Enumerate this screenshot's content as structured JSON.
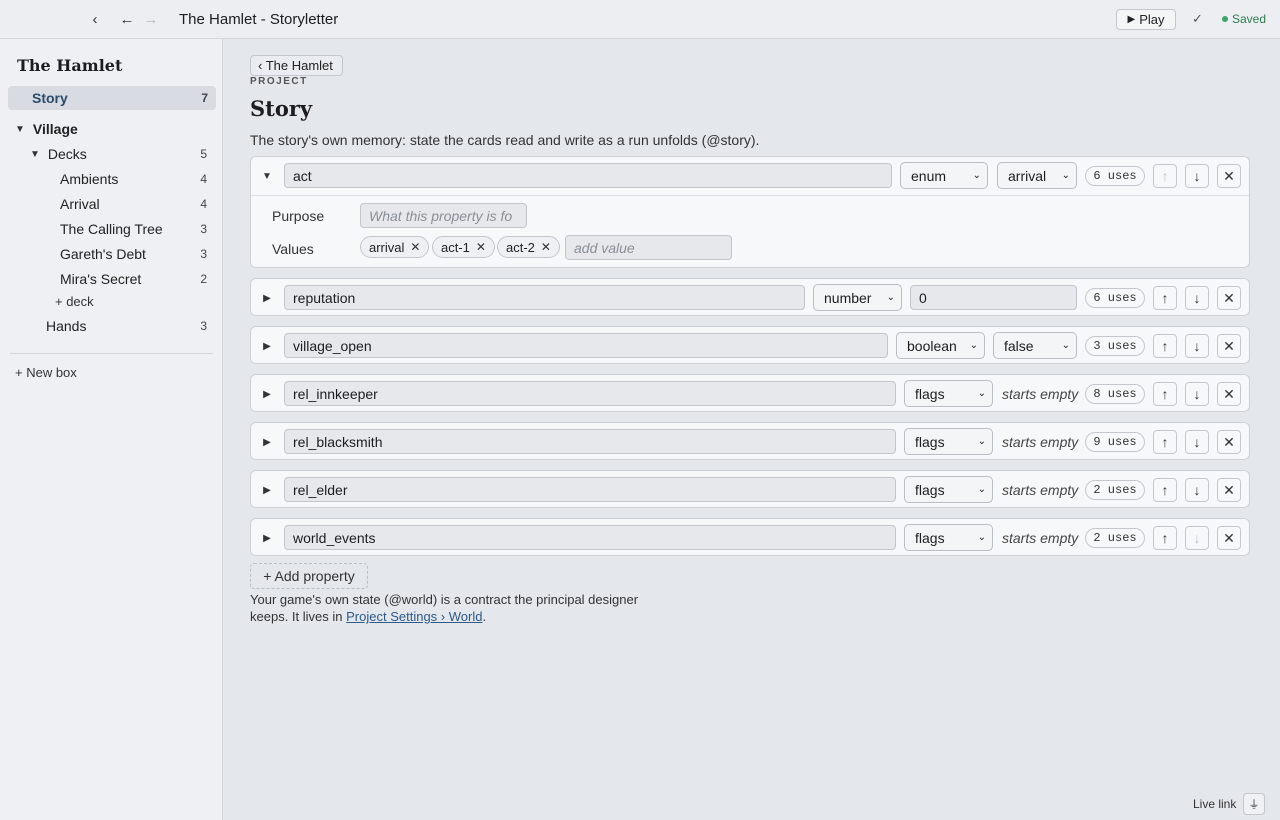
{
  "window": {
    "title": "The Hamlet - Storyletter",
    "play_label": "Play",
    "saved_label": "Saved"
  },
  "sidebar": {
    "project_title": "The Hamlet",
    "story": {
      "label": "Story",
      "count": "7"
    },
    "village": {
      "label": "Village"
    },
    "decks": {
      "label": "Decks",
      "count": "5"
    },
    "deck_items": [
      {
        "label": "Ambients",
        "count": "4"
      },
      {
        "label": "Arrival",
        "count": "4"
      },
      {
        "label": "The Calling Tree",
        "count": "3"
      },
      {
        "label": "Gareth's Debt",
        "count": "3"
      },
      {
        "label": "Mira's Secret",
        "count": "2"
      }
    ],
    "add_deck_label": "+ deck",
    "hands": {
      "label": "Hands",
      "count": "3"
    },
    "new_box_label": "+ New box"
  },
  "main": {
    "breadcrumb": "‹ The Hamlet",
    "eyebrow": "PROJECT",
    "title": "Story",
    "description": "The story's own memory: state the cards read and write as a run unfolds (@story).",
    "properties": [
      {
        "name": "act",
        "type": "enum",
        "default": "arrival",
        "uses": "6 uses",
        "expanded": true
      },
      {
        "name": "reputation",
        "type": "number",
        "default": "0",
        "uses": "6 uses"
      },
      {
        "name": "village_open",
        "type": "boolean",
        "default": "false",
        "uses": "3 uses"
      },
      {
        "name": "rel_innkeeper",
        "type": "flags",
        "default": "starts empty",
        "uses": "8 uses"
      },
      {
        "name": "rel_blacksmith",
        "type": "flags",
        "default": "starts empty",
        "uses": "9 uses"
      },
      {
        "name": "rel_elder",
        "type": "flags",
        "default": "starts empty",
        "uses": "2 uses"
      },
      {
        "name": "world_events",
        "type": "flags",
        "default": "starts empty",
        "uses": "2 uses"
      }
    ],
    "act_detail": {
      "purpose_label": "Purpose",
      "purpose_placeholder": "What this property is fo",
      "values_label": "Values",
      "values": [
        "arrival",
        "act-1",
        "act-2"
      ],
      "add_value_placeholder": "add value"
    },
    "add_property_label": "+ Add property",
    "footnote_text": "Your game's own state (@world) is a contract the principal designer keeps. It lives in",
    "footnote_link": "Project Settings › World",
    "footnote_end": "."
  },
  "footer": {
    "live_link_label": "Live link"
  },
  "icons": {
    "collapse_sidebar": "chevron-left-icon",
    "back": "arrow-left-icon",
    "forward": "arrow-right-icon",
    "move_up": "arrow-up-icon",
    "move_down": "arrow-down-icon",
    "remove": "close-icon",
    "live": "plug-icon"
  },
  "colors": {
    "saved": "#2e7d4f",
    "link": "#2d5a8a",
    "story_selected": "#2d4a6b"
  }
}
